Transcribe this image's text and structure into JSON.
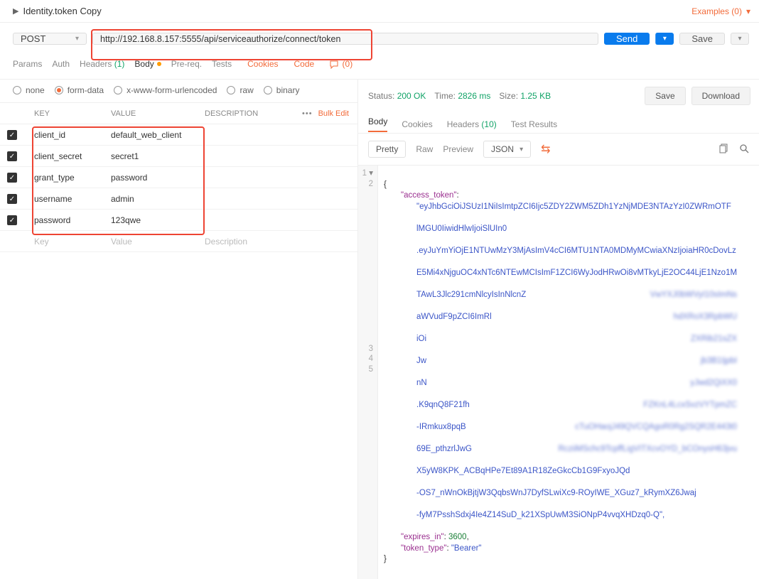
{
  "header": {
    "name": "Identity.token Copy",
    "examples": "Examples (0)"
  },
  "request": {
    "method": "POST",
    "url": "http://192.168.8.157:5555/api/serviceauthorize/connect/token",
    "send": "Send",
    "save": "Save"
  },
  "tabs": {
    "params": "Params",
    "auth": "Auth",
    "headers": "Headers",
    "headers_count": "(1)",
    "body": "Body",
    "prereq": "Pre-req.",
    "tests": "Tests",
    "cookies": "Cookies",
    "code": "Code",
    "comments_count": "(0)"
  },
  "body_types": {
    "none": "none",
    "form_data": "form-data",
    "xform": "x-www-form-urlencoded",
    "raw": "raw",
    "binary": "binary"
  },
  "table": {
    "h_key": "KEY",
    "h_val": "VALUE",
    "h_desc": "DESCRIPTION",
    "bulk": "Bulk Edit",
    "rows": [
      {
        "key": "client_id",
        "value": "default_web_client"
      },
      {
        "key": "client_secret",
        "value": "secret1"
      },
      {
        "key": "grant_type",
        "value": "password"
      },
      {
        "key": "username",
        "value": "admin"
      },
      {
        "key": "password",
        "value": "123qwe"
      }
    ],
    "ph_key": "Key",
    "ph_val": "Value",
    "ph_desc": "Description"
  },
  "response": {
    "status_lbl": "Status:",
    "status": "200 OK",
    "time_lbl": "Time:",
    "time": "2826 ms",
    "size_lbl": "Size:",
    "size": "1.25 KB",
    "save": "Save",
    "download": "Download",
    "tabs": {
      "body": "Body",
      "cookies": "Cookies",
      "headers": "Headers",
      "headers_count": "(10)",
      "tests": "Test Results"
    },
    "tool": {
      "pretty": "Pretty",
      "raw": "Raw",
      "preview": "Preview",
      "json": "JSON"
    },
    "json": {
      "access_token_key": "\"access_token\"",
      "access_token_lines": [
        "\"eyJhbGciOiJSUzI1NiIsImtpZCI6Ijc5ZDY2ZWM5ZDh1YzNjMDE3NTAzYzI0ZWRmOTF",
        "lMGU0IiwidHlwIjoiSlUIn0",
        ".eyJuYmYiOjE1NTUwMzY3MjAsImV4cCI6MTU1NTA0MDMyMCwiaXNzIjoiaHR0cDovLz",
        "E5Mi4xNjguOC4xNTc6NTEwMCIsImF1ZCI6WyJodHRwOi8vMTkyLjE2OC44LjE1Nzo1M",
        "TAwL3Jlc291cmNlcyIsInNlcnZ",
        "aWVudF9pZCI6ImRl",
        "iOi",
        "Jw",
        "nN",
        ".K9qnQ8F21fh",
        "-IRmkux8pqB",
        "69E_pthzrlJwG",
        "X5yW8KPK_ACBqHPe7Et89A1R18ZeGkcCb1G9FxyoJQd",
        "-OS7_nWnOkBjtjW3QqbsWnJ7DyfSLwiXc9-ROyIWE_XGuz7_kRymXZ6Jwaj",
        "-fyM7PsshSdxj4Ie4Z14SuD_k21XSpUwM3SiONpP4vvqXHDzq0-Q\","
      ],
      "blur_right": [
        "VwYXJ0bWVyI10sImNs",
        "hdXRoX3RpbWU",
        "ZXRib21sZX",
        "jb3B1IjpbI",
        "yJwd2QiXX0",
        "FZKnL4LcxSvzVYTpmZC",
        "cTuOHaojJ49QVCQAgoR0Rg2SQR2E443t0",
        "RcziiMSchc9TcpffLigVITXcvOYD_bCOnysH63jvu"
      ],
      "expires_in_key": "\"expires_in\"",
      "expires_in": "3600",
      "token_type_key": "\"token_type\"",
      "token_type": "\"Bearer\""
    }
  }
}
